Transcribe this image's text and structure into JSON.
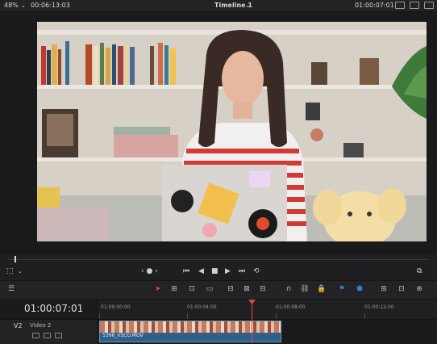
{
  "topbar": {
    "zoom": "48%",
    "source_timecode": "00:06:13:03",
    "timeline_name": "Timeline 1",
    "record_timecode": "01:00:07:01"
  },
  "viewer": {
    "jog_indicator": "‹ ● ›"
  },
  "timeline": {
    "timecode": "01:00:07:01",
    "ruler_ticks": [
      "01:00:00:00",
      "01:00:04:00",
      "01:00:08:00",
      "01:00:12:00"
    ],
    "track": {
      "id": "V2",
      "name": "Video 2"
    },
    "clip_name": "5396_VSCO.MOV"
  },
  "colors": {
    "playhead": "#e2483a",
    "clip": "#2f5f8a",
    "accent_blue": "#2f7de1"
  }
}
